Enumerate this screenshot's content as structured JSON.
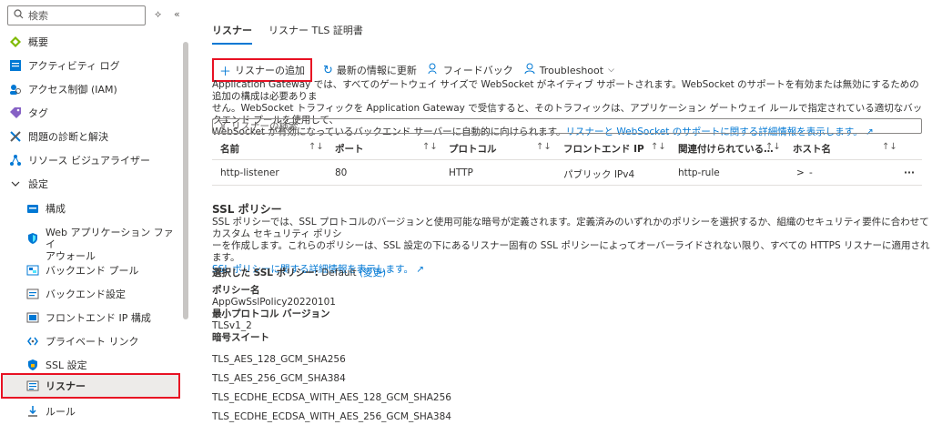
{
  "sidebar": {
    "search_placeholder": "検索",
    "items": [
      {
        "label": "概要",
        "icon": "overview-icon",
        "color": "#7fba00"
      },
      {
        "label": "アクティビティ ログ",
        "icon": "activity-log-icon",
        "color": "#0078d4"
      },
      {
        "label": "アクセス制御 (IAM)",
        "icon": "iam-icon",
        "color": "#0078d4"
      },
      {
        "label": "タグ",
        "icon": "tag-icon",
        "color": "#8661c5"
      },
      {
        "label": "問題の診断と解決",
        "icon": "diagnose-icon",
        "color": "#0078d4"
      },
      {
        "label": "リソース ビジュアライザー",
        "icon": "visualizer-icon",
        "color": "#0078d4"
      },
      {
        "label": "設定",
        "icon": "chevron-down-icon"
      }
    ],
    "settings_items": [
      {
        "label": "構成",
        "icon": "config-icon"
      },
      {
        "label": "Web アプリケーション ファイ",
        "label2": "アウォール",
        "icon": "waf-icon"
      },
      {
        "label": "バックエンド プール",
        "icon": "backend-pool-icon"
      },
      {
        "label": "バックエンド設定",
        "icon": "backend-settings-icon"
      },
      {
        "label": "フロントエンド IP 構成",
        "icon": "frontend-ip-icon"
      },
      {
        "label": "プライベート リンク",
        "icon": "private-link-icon"
      },
      {
        "label": "SSL 設定",
        "icon": "ssl-icon"
      },
      {
        "label": "リスナー",
        "icon": "listener-icon",
        "selected": true
      },
      {
        "label": "ルール",
        "icon": "rules-icon"
      }
    ]
  },
  "tabs": [
    {
      "label": "リスナー",
      "active": true
    },
    {
      "label": "リスナー TLS 証明書",
      "active": false
    }
  ],
  "toolbar": {
    "add": "リスナーの追加",
    "refresh": "最新の情報に更新",
    "feedback": "フィードバック",
    "troubleshoot": "Troubleshoot"
  },
  "description": {
    "line1": "Application Gateway では、すべてのゲートウェイ サイズで WebSocket がネイティブ サポートされます。WebSocket のサポートを有効または無効にするための追加の構成は必要ありま",
    "line2": "せん。WebSocket トラフィックを Application Gateway で受信すると、そのトラフィックは、アプリケーション ゲートウェイ ルールで指定されている適切なバックエンド プールを使用して、",
    "line3": "WebSocket が有効になっているバックエンド サーバーに自動的に向けられます。",
    "link": "リスナーと WebSocket のサポートに関する詳細情報を表示します。"
  },
  "filter_placeholder": "リスナーの検索",
  "table": {
    "headers": [
      "名前",
      "ポート",
      "プロトコル",
      "フロントエンド IP",
      "関連付けられている…",
      "ホスト名"
    ],
    "rows": [
      {
        "name": "http-listener",
        "port": "80",
        "protocol": "HTTP",
        "frontend": "パブリック IPv4",
        "rule": "http-rule",
        "host": "-"
      }
    ]
  },
  "ssl": {
    "title": "SSL ポリシー",
    "desc1": "SSL ポリシーでは、SSL プロトコルのバージョンと使用可能な暗号が定義されます。定義済みのいずれかのポリシーを選択するか、組織のセキュリティ要件に合わせてカスタム セキュリティ ポリシ",
    "desc2": "ーを作成します。これらのポリシーは、SSL 設定の下にあるリスナー固有の SSL ポリシーによってオーバーライドされない限り、すべての HTTPS リスナーに適用されます。",
    "link": "SSL ポリシーに関する詳細情報を表示します。",
    "selected_label": "選択した SSL ポリシー:",
    "selected_value": "Default",
    "change": "(変更)",
    "policy_name_label": "ポリシー名",
    "policy_name": "AppGwSslPolicy20220101",
    "min_protocol_label": "最小プロトコル バージョン",
    "min_protocol": "TLSv1_2",
    "cipher_label": "暗号スイート",
    "ciphers": [
      "TLS_AES_128_GCM_SHA256",
      "TLS_AES_256_GCM_SHA384",
      "TLS_ECDHE_ECDSA_WITH_AES_128_GCM_SHA256",
      "TLS_ECDHE_ECDSA_WITH_AES_256_GCM_SHA384"
    ]
  }
}
